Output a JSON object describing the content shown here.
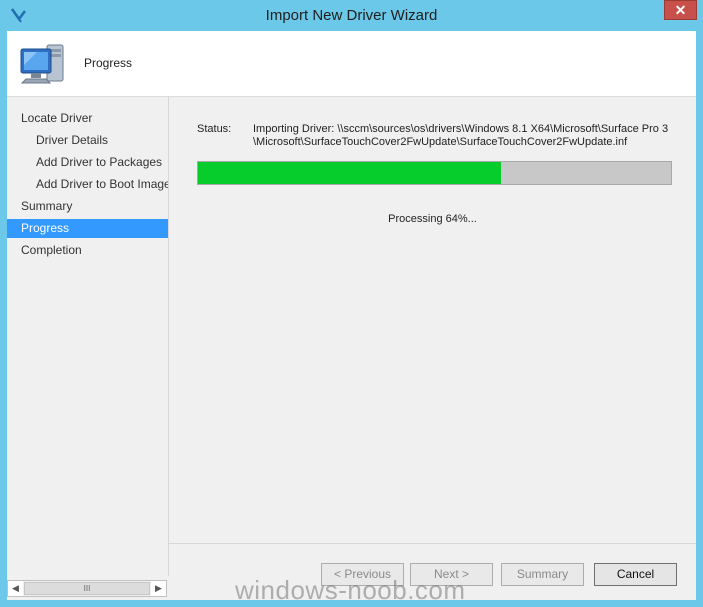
{
  "window": {
    "title": "Import New Driver Wizard",
    "close_label": "✕"
  },
  "header": {
    "title": "Progress",
    "icon": "computer-icon"
  },
  "nav": {
    "items": [
      {
        "label": "Locate Driver",
        "level": 0,
        "active": false
      },
      {
        "label": "Driver Details",
        "level": 1,
        "active": false
      },
      {
        "label": "Add Driver to Packages",
        "level": 1,
        "active": false
      },
      {
        "label": "Add Driver to Boot Image",
        "level": 1,
        "active": false
      },
      {
        "label": "Summary",
        "level": 0,
        "active": false
      },
      {
        "label": "Progress",
        "level": 0,
        "active": true
      },
      {
        "label": "Completion",
        "level": 0,
        "active": false
      }
    ]
  },
  "content": {
    "status_label": "Status:",
    "status_text": "Importing Driver: \\\\sccm\\sources\\os\\drivers\\Windows 8.1 X64\\Microsoft\\Surface Pro 3\\Microsoft\\SurfaceTouchCover2FwUpdate\\SurfaceTouchCover2FwUpdate.inf",
    "progress_percent": 64,
    "processing_text": "Processing 64%..."
  },
  "buttons": {
    "previous": "< Previous",
    "next": "Next >",
    "summary": "Summary",
    "cancel": "Cancel"
  },
  "scrollbar": {
    "thumb_glyph": "III"
  },
  "watermark": "windows-noob.com",
  "colors": {
    "titlebar": "#6cc8e8",
    "progress_fill": "#06cc2c",
    "selection": "#3399ff",
    "close": "#c7504a"
  }
}
